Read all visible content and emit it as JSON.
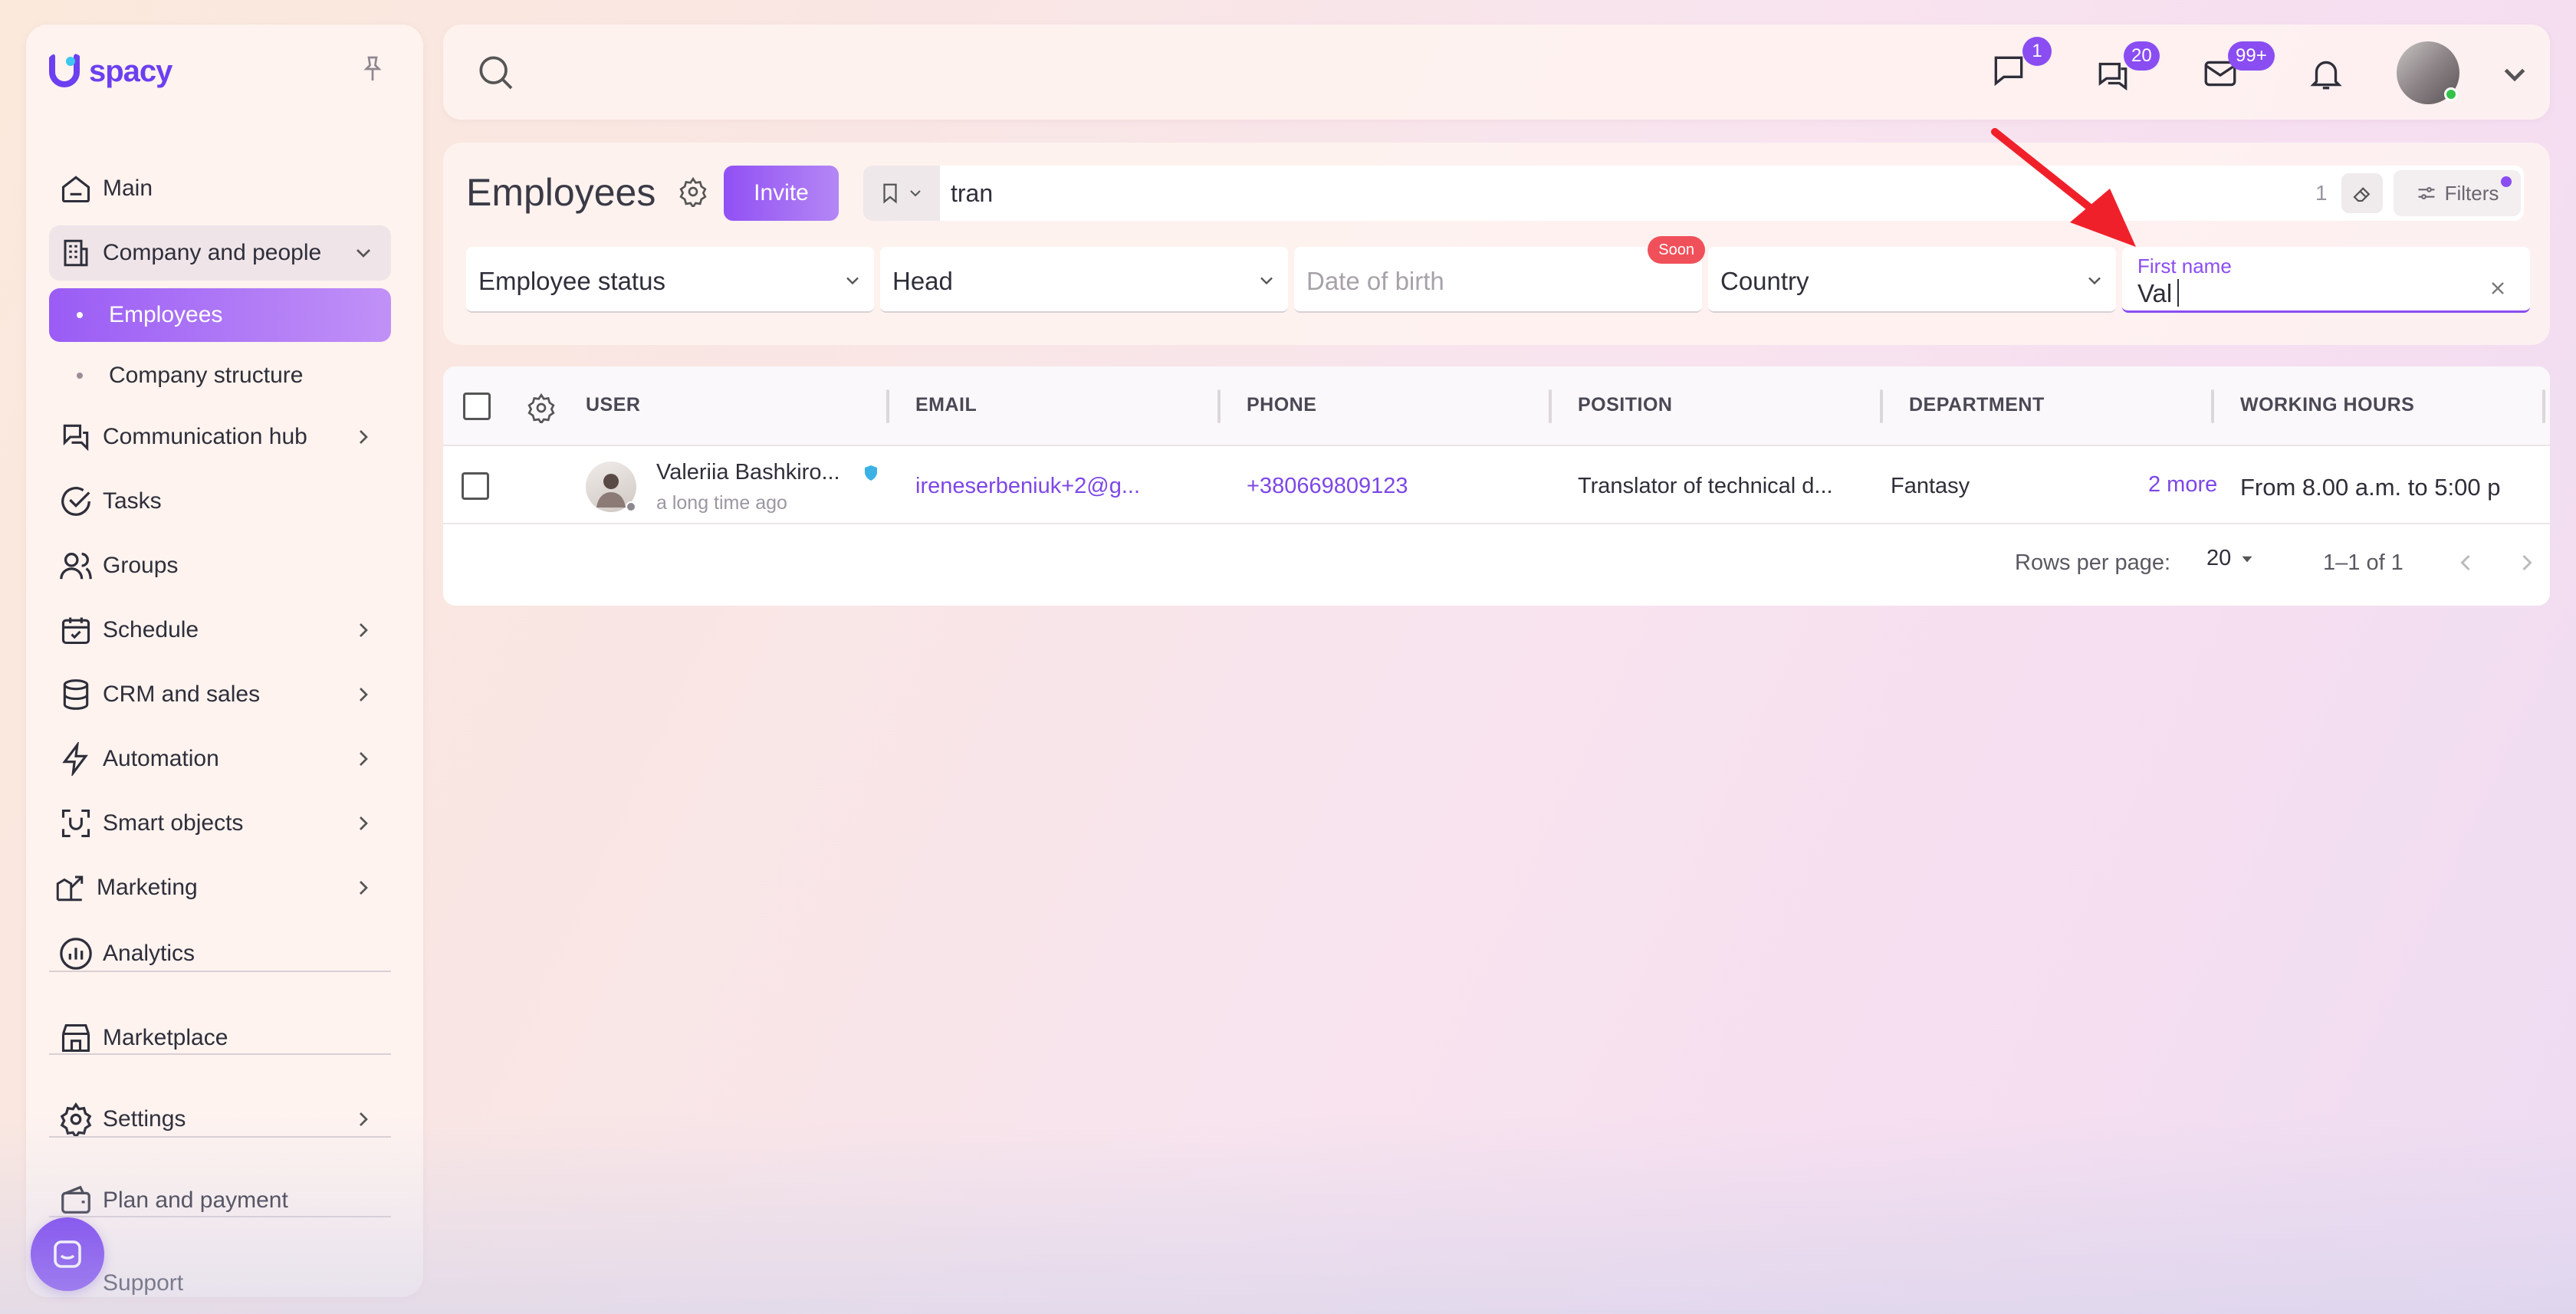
{
  "app": {
    "brand": "spacy"
  },
  "sidebar": {
    "items": [
      {
        "label": "Main",
        "icon": "home-icon"
      },
      {
        "label": "Company and people",
        "icon": "building-icon"
      },
      {
        "label": "Employees"
      },
      {
        "label": "Company structure"
      },
      {
        "label": "Communication hub",
        "icon": "chat-icon"
      },
      {
        "label": "Tasks",
        "icon": "check-circle-icon"
      },
      {
        "label": "Groups",
        "icon": "users-icon"
      },
      {
        "label": "Schedule",
        "icon": "calendar-icon"
      },
      {
        "label": "CRM and sales",
        "icon": "database-icon"
      },
      {
        "label": "Automation",
        "icon": "lightning-icon"
      },
      {
        "label": "Smart objects",
        "icon": "scan-icon"
      },
      {
        "label": "Marketing",
        "icon": "marketing-icon"
      },
      {
        "label": "Analytics",
        "icon": "analytics-icon"
      },
      {
        "label": "Marketplace",
        "icon": "store-icon"
      },
      {
        "label": "Settings",
        "icon": "gear-icon"
      },
      {
        "label": "Plan and payment",
        "icon": "wallet-icon"
      },
      {
        "label": "Support",
        "icon": "support-icon"
      }
    ]
  },
  "topbar": {
    "badges": {
      "messages": "1",
      "chats": "20",
      "mail": "99+"
    }
  },
  "page": {
    "title": "Employees",
    "invite_label": "Invite",
    "search_value": "tran",
    "filter_count": "1",
    "filters_label": "Filters"
  },
  "filters": {
    "employee_status": "Employee status",
    "head": "Head",
    "date_of_birth": "Date of birth",
    "soon": "Soon",
    "country": "Country",
    "first_name_label": "First name",
    "first_name_value": "Val"
  },
  "table": {
    "headers": [
      "USER",
      "EMAIL",
      "PHONE",
      "POSITION",
      "DEPARTMENT",
      "WORKING HOURS"
    ],
    "rows": [
      {
        "name": "Valeriia Bashkiro...",
        "last_seen": "a long time ago",
        "email": "ireneserbeniuk+2@g...",
        "phone": "+380669809123",
        "position": "Translator of technical d...",
        "department": "Fantasy",
        "more": "2 more",
        "hours": "From 8.00 a.m. to 5:00 p"
      }
    ],
    "footer": {
      "rows_per_page_label": "Rows per page:",
      "rows_per_page": "20",
      "range": "1–1 of 1"
    }
  },
  "colors": {
    "accent": "#8a4df2",
    "brand": "#6c3ff0",
    "danger": "#f0505a",
    "annotation_arrow": "#f0202a"
  }
}
